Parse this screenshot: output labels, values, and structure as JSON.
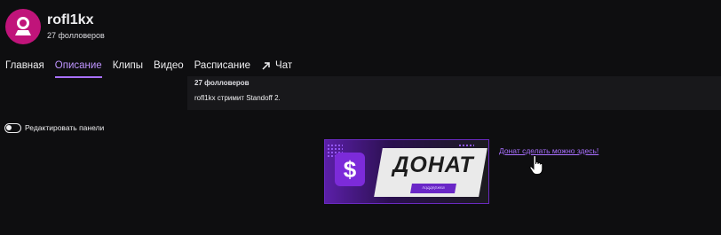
{
  "channel": {
    "name": "rofl1kx",
    "followers": "27 фолловеров"
  },
  "tabs": [
    {
      "label": "Главная",
      "active": false
    },
    {
      "label": "Описание",
      "active": true
    },
    {
      "label": "Клипы",
      "active": false
    },
    {
      "label": "Видео",
      "active": false
    },
    {
      "label": "Расписание",
      "active": false
    },
    {
      "label": "Чат",
      "active": false,
      "icon": "external-arrow-icon"
    }
  ],
  "about": {
    "followers": "27 фолловеров",
    "description": "rofl1kx стримит Standoff 2."
  },
  "panels": {
    "edit_label": "Редактировать панели",
    "edit_enabled": false
  },
  "donate": {
    "banner_symbol": "$",
    "banner_word": "ДОНАТ",
    "banner_sub": "поддержка",
    "link_text": "Донат сделать можно здесь!"
  },
  "colors": {
    "accent": "#a970ff",
    "avatar": "#c0147a",
    "background": "#0e0e10",
    "panel": "#18181b"
  }
}
